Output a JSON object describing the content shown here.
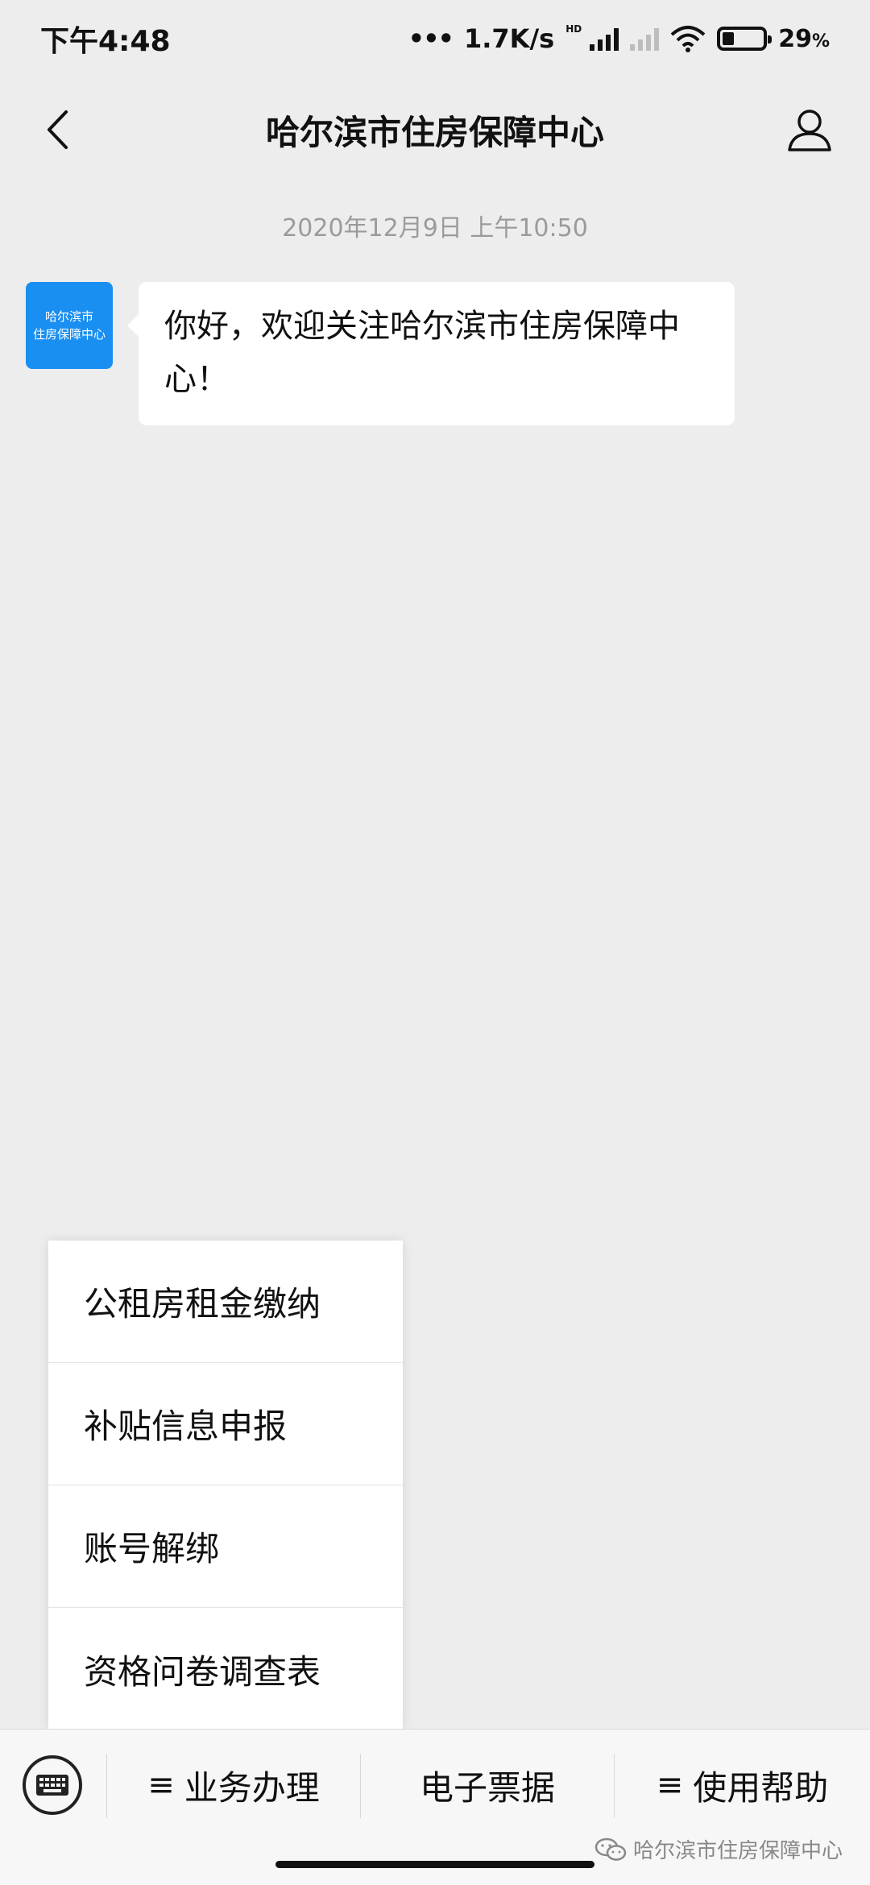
{
  "status_bar": {
    "time": "下午4:48",
    "dots": "•••",
    "network_speed": "1.7K/s",
    "hd_label": "HD",
    "battery_percent": "29",
    "battery_suffix": "%",
    "battery_level": 0.29
  },
  "header": {
    "title": "哈尔滨市住房保障中心"
  },
  "chat": {
    "timestamp": "2020年12月9日 上午10:50",
    "avatar_text_line1": "哈尔滨市",
    "avatar_text_line2": "住房保障中心",
    "messages": [
      {
        "text": "你好，欢迎关注哈尔滨市住房保障中心！"
      }
    ]
  },
  "popup_menu": {
    "items": [
      {
        "label": "公租房租金缴纳"
      },
      {
        "label": "补贴信息申报"
      },
      {
        "label": "账号解绑"
      },
      {
        "label": "资格问卷调查表"
      }
    ]
  },
  "bottom_menu": {
    "prefix_symbol": "≡",
    "items": [
      {
        "label": "业务办理",
        "has_submenu": true
      },
      {
        "label": "电子票据",
        "has_submenu": false
      },
      {
        "label": "使用帮助",
        "has_submenu": true
      }
    ]
  },
  "watermark": {
    "text": "哈尔滨市住房保障中心"
  },
  "icons": {
    "back": "chevron-left-icon",
    "profile": "person-icon",
    "keyboard": "keyboard-icon",
    "watermark": "wechat-icon"
  },
  "colors": {
    "background": "#ededed",
    "avatar": "#1a8ff2",
    "bubble": "#ffffff"
  }
}
